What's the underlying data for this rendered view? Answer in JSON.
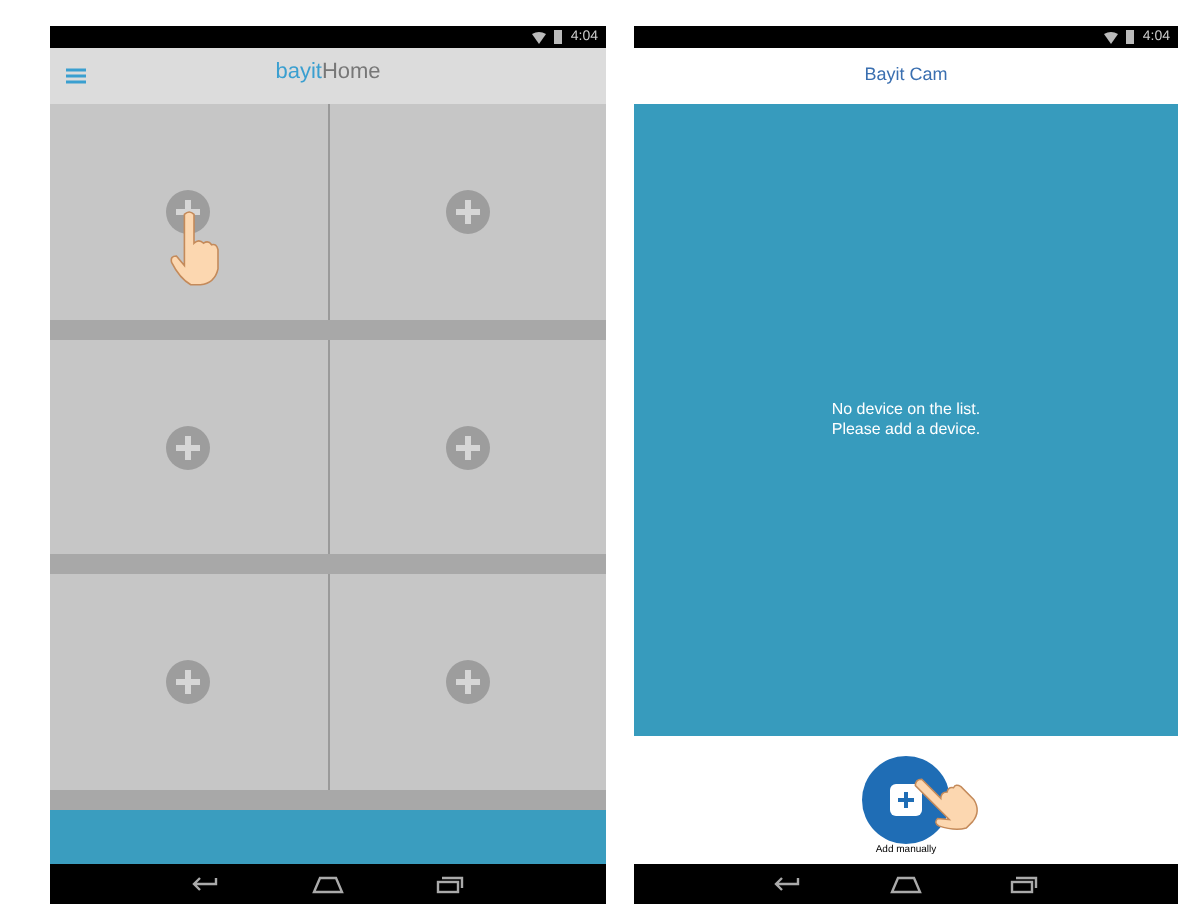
{
  "left_screen": {
    "status_bar": {
      "time": "4:04"
    },
    "header": {
      "logo": {
        "first": "bayit",
        "second": "Home"
      }
    },
    "tiles": [
      {
        "hand": true
      },
      {
        "hand": false
      },
      {
        "hand": false
      },
      {
        "hand": false
      },
      {
        "hand": false
      },
      {
        "hand": false
      }
    ]
  },
  "right_screen": {
    "status_bar": {
      "time": "4:04"
    },
    "header": {
      "title": "Bayit Cam"
    },
    "message": [
      "No device on the list.",
      "Please add a device."
    ],
    "add_button": {
      "label": "Add manually"
    }
  }
}
